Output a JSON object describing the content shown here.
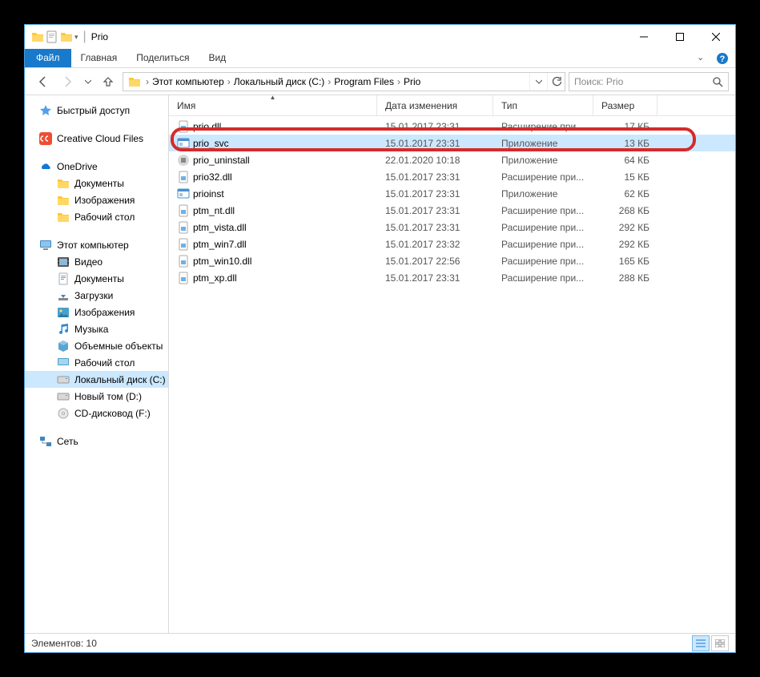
{
  "window": {
    "title": "Prio"
  },
  "ribbon": {
    "file": "Файл",
    "tabs": [
      "Главная",
      "Поделиться",
      "Вид"
    ]
  },
  "breadcrumbs": [
    "Этот компьютер",
    "Локальный диск (C:)",
    "Program Files",
    "Prio"
  ],
  "search": {
    "placeholder": "Поиск: Prio"
  },
  "tree": {
    "quick": "Быстрый доступ",
    "ccf": "Creative Cloud Files",
    "onedrive": "OneDrive",
    "od_items": [
      "Документы",
      "Изображения",
      "Рабочий стол"
    ],
    "thispc": "Этот компьютер",
    "pc_items": [
      "Видео",
      "Документы",
      "Загрузки",
      "Изображения",
      "Музыка",
      "Объемные объекты",
      "Рабочий стол"
    ],
    "disk_c": "Локальный диск (C:)",
    "disk_d": "Новый том (D:)",
    "disk_f": "CD-дисковод (F:)",
    "network": "Сеть"
  },
  "columns": {
    "name": "Имя",
    "date": "Дата изменения",
    "type": "Тип",
    "size": "Размер"
  },
  "files": [
    {
      "icon": "dll",
      "name": "prio.dll",
      "date": "15.01.2017 23:31",
      "type": "Расширение при...",
      "size": "17 КБ"
    },
    {
      "icon": "exe",
      "name": "prio_svc",
      "date": "15.01.2017 23:31",
      "type": "Приложение",
      "size": "13 КБ",
      "selected": true
    },
    {
      "icon": "uni",
      "name": "prio_uninstall",
      "date": "22.01.2020 10:18",
      "type": "Приложение",
      "size": "64 КБ"
    },
    {
      "icon": "dll",
      "name": "prio32.dll",
      "date": "15.01.2017 23:31",
      "type": "Расширение при...",
      "size": "15 КБ"
    },
    {
      "icon": "exe",
      "name": "prioinst",
      "date": "15.01.2017 23:31",
      "type": "Приложение",
      "size": "62 КБ"
    },
    {
      "icon": "dll",
      "name": "ptm_nt.dll",
      "date": "15.01.2017 23:31",
      "type": "Расширение при...",
      "size": "268 КБ"
    },
    {
      "icon": "dll",
      "name": "ptm_vista.dll",
      "date": "15.01.2017 23:31",
      "type": "Расширение при...",
      "size": "292 КБ"
    },
    {
      "icon": "dll",
      "name": "ptm_win7.dll",
      "date": "15.01.2017 23:32",
      "type": "Расширение при...",
      "size": "292 КБ"
    },
    {
      "icon": "dll",
      "name": "ptm_win10.dll",
      "date": "15.01.2017 22:56",
      "type": "Расширение при...",
      "size": "165 КБ"
    },
    {
      "icon": "dll",
      "name": "ptm_xp.dll",
      "date": "15.01.2017 23:31",
      "type": "Расширение при...",
      "size": "288 КБ"
    }
  ],
  "status": {
    "count": "Элементов: 10"
  }
}
